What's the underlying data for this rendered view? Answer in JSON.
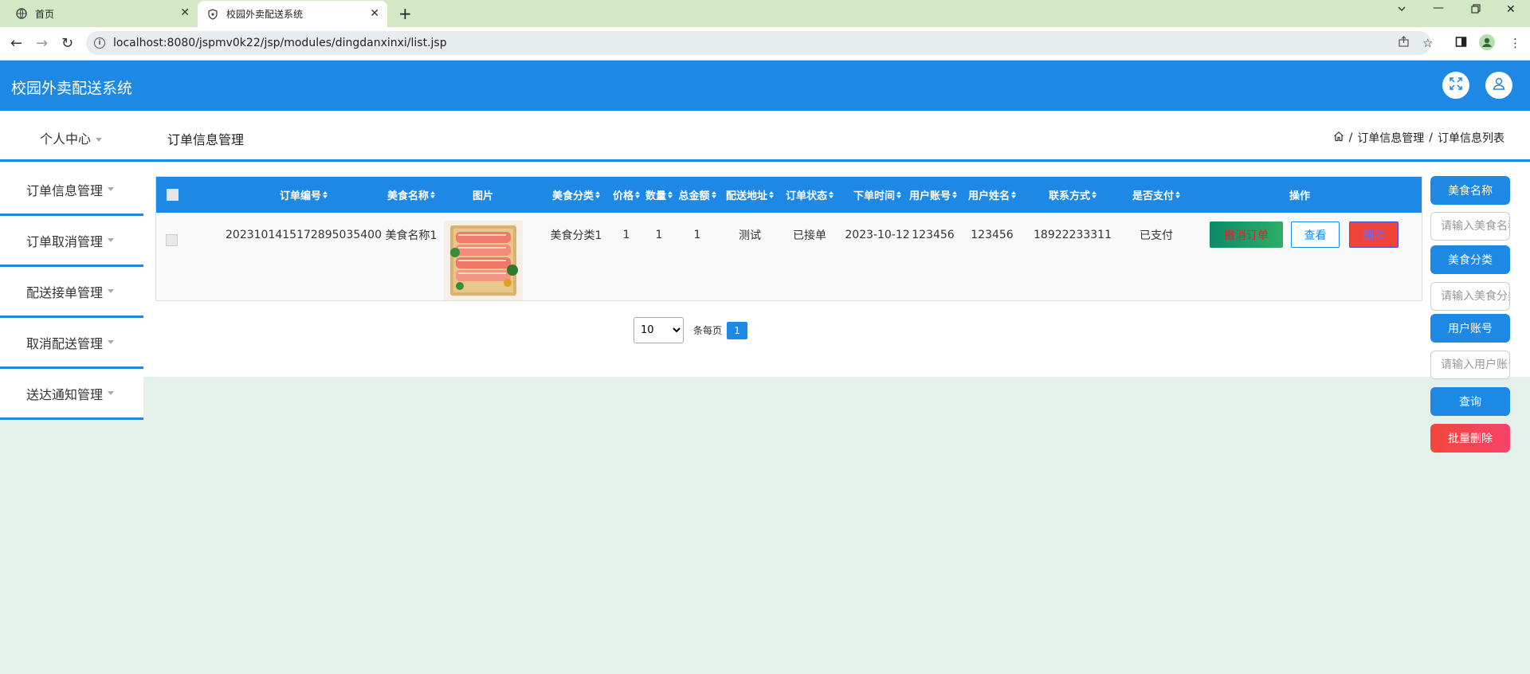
{
  "browser": {
    "tabs": [
      {
        "title": "首页"
      },
      {
        "title": "校园外卖配送系统"
      }
    ],
    "url": "localhost:8080/jspmv0k22/jsp/modules/dingdanxinxi/list.jsp"
  },
  "app": {
    "title": "校园外卖配送系统"
  },
  "topnav": {
    "personal_center": "个人中心",
    "page_title": "订单信息管理",
    "breadcrumb": [
      "订单信息管理",
      "订单信息列表"
    ]
  },
  "sidebar": {
    "items": [
      {
        "label": "订单信息管理"
      },
      {
        "label": "订单取消管理"
      },
      {
        "label": "配送接单管理"
      },
      {
        "label": "取消配送管理"
      },
      {
        "label": "送达通知管理"
      }
    ]
  },
  "table": {
    "headers": [
      "订单编号",
      "美食名称",
      "图片",
      "美食分类",
      "价格",
      "数量",
      "总金额",
      "配送地址",
      "订单状态",
      "下单时间",
      "用户账号",
      "用户姓名",
      "联系方式",
      "是否支付",
      "操作"
    ],
    "rows": [
      {
        "order_no": "2023101415172895035400",
        "food_name": "美食名称1",
        "category": "美食分类1",
        "price": "1",
        "quantity": "1",
        "total": "1",
        "address": "测试",
        "status": "已接单",
        "order_time": "2023-10-12",
        "user_account": "123456",
        "user_name": "123456",
        "contact": "18922233311",
        "paid": "已支付",
        "actions": {
          "cancel": "撤消订单",
          "view": "查看",
          "delete": "删除"
        }
      }
    ]
  },
  "pager": {
    "page_size": "10",
    "per_page_label": "条每页",
    "current_page": "1"
  },
  "search": {
    "food_name_label": "美食名称",
    "food_name_placeholder": "请输入美食名称",
    "category_label": "美食分类",
    "category_placeholder": "请输入美食分类",
    "account_label": "用户账号",
    "account_placeholder": "请输入用户账号",
    "query_button": "查询",
    "batch_delete_button": "批量删除"
  },
  "colors": {
    "primary": "#1e88e5",
    "tabbar": "#d3e9c5",
    "page_bg": "#e4f1ea",
    "danger": "#f4473a"
  }
}
